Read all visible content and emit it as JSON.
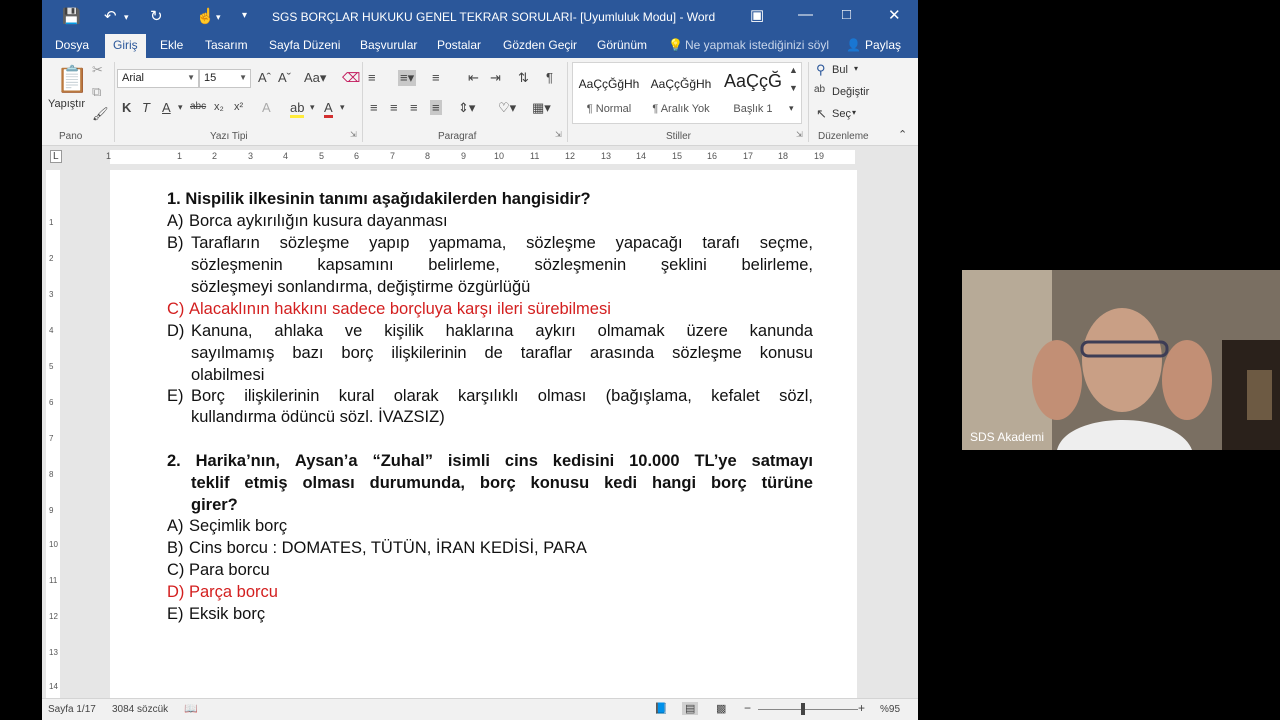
{
  "window": {
    "title": "SGS BORÇLAR HUKUKU GENEL TEKRAR SORULARI- [Uyumluluk Modu]  -  Word"
  },
  "tabs": [
    "Dosya",
    "Giriş",
    "Ekle",
    "Tasarım",
    "Sayfa Düzeni",
    "Başvurular",
    "Postalar",
    "Gözden Geçir",
    "Görünüm"
  ],
  "tell_me": "Ne yapmak istediğinizi söyl",
  "share": "Paylaş",
  "ribbon": {
    "paste": "Yapıştır",
    "font_name": "Arial",
    "font_size": "15",
    "styles": [
      {
        "sample": "AaÇçĞğHh",
        "name": "¶ Normal"
      },
      {
        "sample": "AaÇçĞğHh",
        "name": "¶ Aralık Yok"
      },
      {
        "sample": "AaÇçĞ",
        "name": "Başlık 1"
      }
    ],
    "find": "Bul",
    "replace": "Değiştir",
    "select": "Seç",
    "groups": [
      "Pano",
      "Yazı Tipi",
      "Paragraf",
      "Stiller",
      "Düzenleme"
    ]
  },
  "document": {
    "q1": {
      "title": "1. Nispilik ilkesinin tanımı aşağıdakilerden hangisidir?",
      "a_label": "A)",
      "a": "Borca aykırılığın kusura dayanması",
      "b_label": "B)",
      "b1": [
        "Tarafların",
        "sözleşme",
        "yapıp",
        "yapmama,",
        "sözleşme",
        "yapacağı",
        "tarafı",
        "seçme,"
      ],
      "b2": [
        "sözleşmenin",
        "kapsamını",
        "belirleme,",
        "sözleşmenin",
        "şeklini",
        "belirleme,"
      ],
      "b3": "sözleşmeyi sonlandırma, değiştirme özgürlüğü",
      "c_label": "C)",
      "c": "Alacaklının hakkını sadece borçluya karşı ileri sürebilmesi",
      "d_label": "D)",
      "d1": [
        "Kanuna,",
        "ahlaka",
        "ve",
        "kişilik",
        "haklarına",
        "aykırı",
        "olmamak",
        "üzere",
        "kanunda"
      ],
      "d2": [
        "sayılmamış",
        "bazı",
        "borç",
        "ilişkilerinin",
        "de",
        "taraflar",
        "arasında",
        "sözleşme",
        "konusu"
      ],
      "d3": "olabilmesi",
      "e_label": "E)",
      "e1": [
        "Borç",
        "ilişkilerinin",
        "kural",
        "olarak",
        "karşılıklı",
        "olması",
        "(bağışlama,",
        "kefalet",
        "sözl,"
      ],
      "e2": "kullandırma ödüncü sözl. İVAZSIZ)"
    },
    "q2": {
      "title1": [
        "2.",
        "Harika’nın,",
        "Aysan’a",
        "“Zuhal”",
        "isimli",
        "cins",
        "kedisini",
        "10.000",
        "TL’ye",
        "satmayı"
      ],
      "title2": [
        "teklif",
        "etmiş",
        "olması",
        "durumunda,",
        "borç",
        "konusu",
        "kedi",
        "hangi",
        "borç",
        "türüne"
      ],
      "title3": "girer?",
      "a_label": "A)",
      "a": "Seçimlik borç",
      "b_label": "B)",
      "b": "Cins borcu : DOMATES, TÜTÜN, İRAN KEDİSİ, PARA",
      "c_label": "C)",
      "c": "Para borcu",
      "d_label": "D)",
      "d": "Parça borcu",
      "e_label": "E)",
      "e": "Eksik borç"
    }
  },
  "status": {
    "page": "Sayfa 1/17",
    "words": "3084 sözcük",
    "zoom": "%95"
  },
  "webcam": {
    "label": "SDS Akademi"
  },
  "colors": {
    "word_blue": "#2b579a",
    "answer_red": "#d31f1f"
  }
}
